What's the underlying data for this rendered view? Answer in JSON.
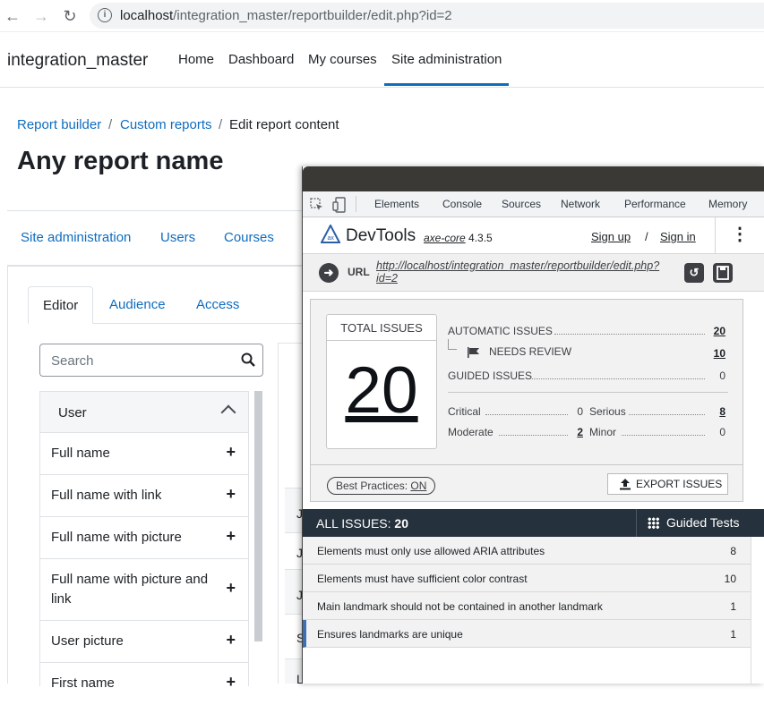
{
  "browser": {
    "url_host": "localhost",
    "url_path": "/integration_master/reportbuilder/edit.php?id=2"
  },
  "site": {
    "brand": "integration_master",
    "nav": [
      "Home",
      "Dashboard",
      "My courses",
      "Site administration"
    ],
    "breadcrumb": [
      "Report builder",
      "/",
      "Custom reports",
      "/",
      "Edit report content"
    ],
    "page_title": "Any report name",
    "secondary_nav": [
      "Site administration",
      "Users",
      "Courses"
    ],
    "tabs": [
      "Editor",
      "Audience",
      "Access"
    ],
    "search_placeholder": "Search",
    "group": "User",
    "items": [
      "Full name",
      "Full name with link",
      "Full name with picture",
      "Full name with picture and link",
      "User picture",
      "First name"
    ],
    "plus": "+",
    "right_cells": [
      "J",
      "J",
      "J",
      "S",
      "L"
    ]
  },
  "devtools": {
    "tabs": [
      "Elements",
      "Console",
      "Sources",
      "Network",
      "Performance",
      "Memory"
    ],
    "axe": {
      "title": "DevTools",
      "engine": "axe-core",
      "version": "4.3.5",
      "sign_up": "Sign up",
      "sep": "/",
      "sign_in": "Sign in",
      "url_label": "URL",
      "url": "http://localhost/integration_master/reportbuilder/edit.php?id=2",
      "total_label": "TOTAL ISSUES",
      "total": "20",
      "automatic_label": "AUTOMATIC ISSUES",
      "automatic": "20",
      "needs_review_label": "NEEDS REVIEW",
      "needs_review": "10",
      "guided_label": "GUIDED ISSUES",
      "guided": "0",
      "critical_label": "Critical",
      "critical": "0",
      "serious_label": "Serious",
      "serious": "8",
      "moderate_label": "Moderate",
      "moderate": "2",
      "minor_label": "Minor",
      "minor": "0",
      "best_practices_label": "Best Practices:",
      "best_practices_value": "ON",
      "export": "EXPORT ISSUES",
      "all_issues_label": "ALL ISSUES:",
      "all_issues": "20",
      "guided_tests": "Guided Tests",
      "issues": [
        {
          "name": "Elements must only use allowed ARIA attributes",
          "count": "8"
        },
        {
          "name": "Elements must have sufficient color contrast",
          "count": "10"
        },
        {
          "name": "Main landmark should not be contained in another landmark",
          "count": "1"
        },
        {
          "name": "Ensures landmarks are unique",
          "count": "1"
        }
      ]
    }
  }
}
